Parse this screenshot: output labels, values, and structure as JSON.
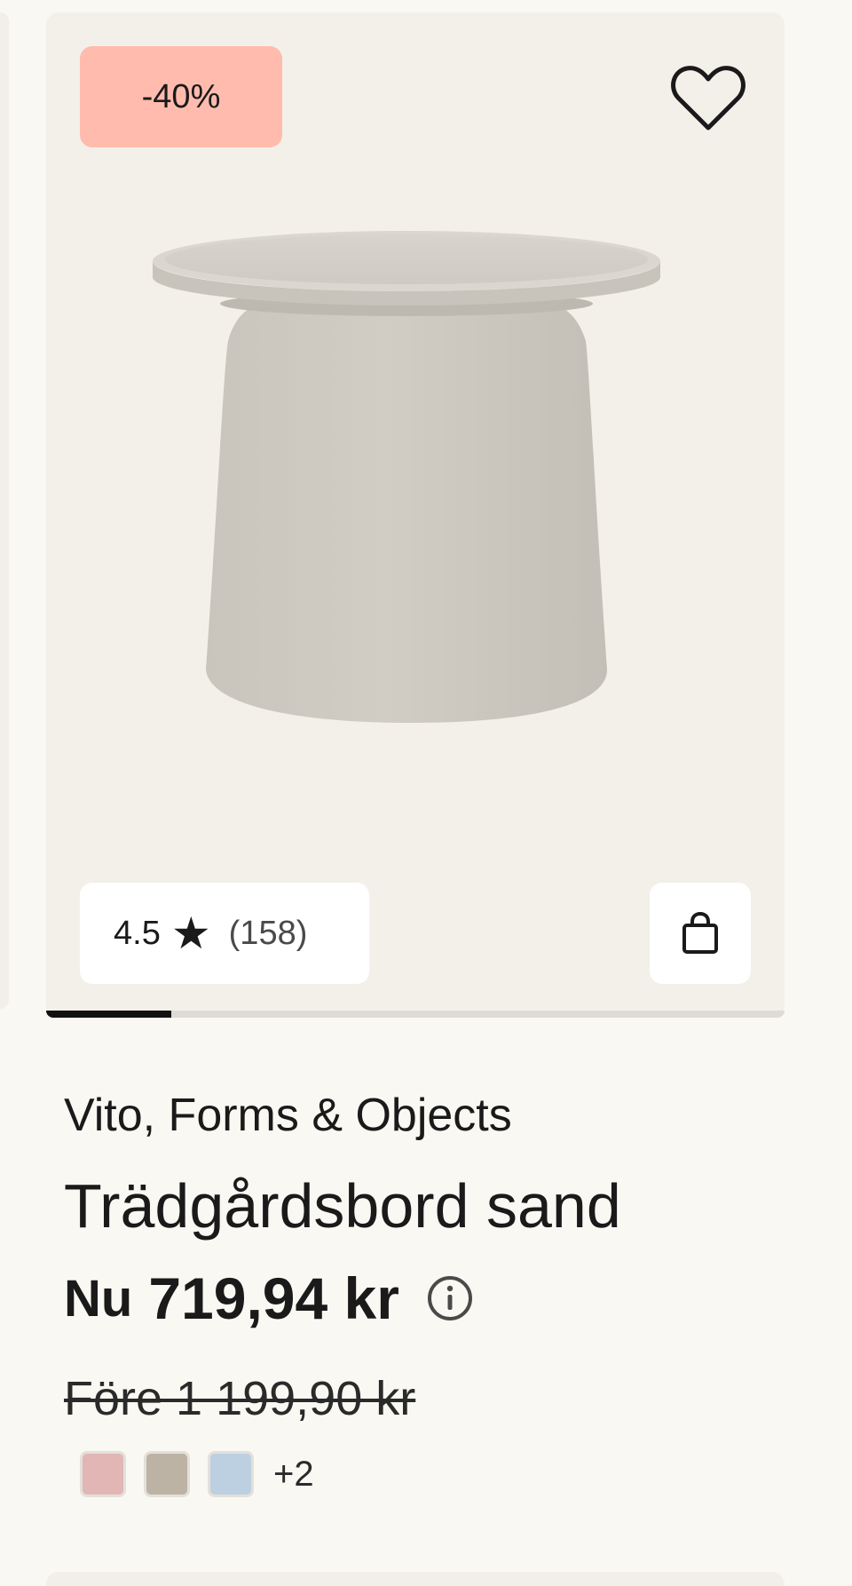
{
  "product": {
    "discount_badge": "-40%",
    "rating": {
      "score": "4.5",
      "star": "★",
      "count": "(158)"
    },
    "image_carousel": {
      "progress": 0.17
    },
    "brand": "Vito, Forms & Objects",
    "title": "Trädgårdsbord sand",
    "price": {
      "prefix": "Nu",
      "current": "719,94 kr",
      "before": "Före 1 199,90 kr"
    },
    "colors": {
      "swatches": [
        "#e3b6b6",
        "#bdb3a5",
        "#bcd0e2"
      ],
      "more": "+2"
    },
    "icons": {
      "favorite": "heart-outline-icon",
      "cart": "shopping-bag-icon",
      "info": "info-icon"
    }
  },
  "theme": {
    "badge_color": "#ffbcae",
    "card_background": "#f3f0e9",
    "page_background": "#f9f8f3"
  }
}
